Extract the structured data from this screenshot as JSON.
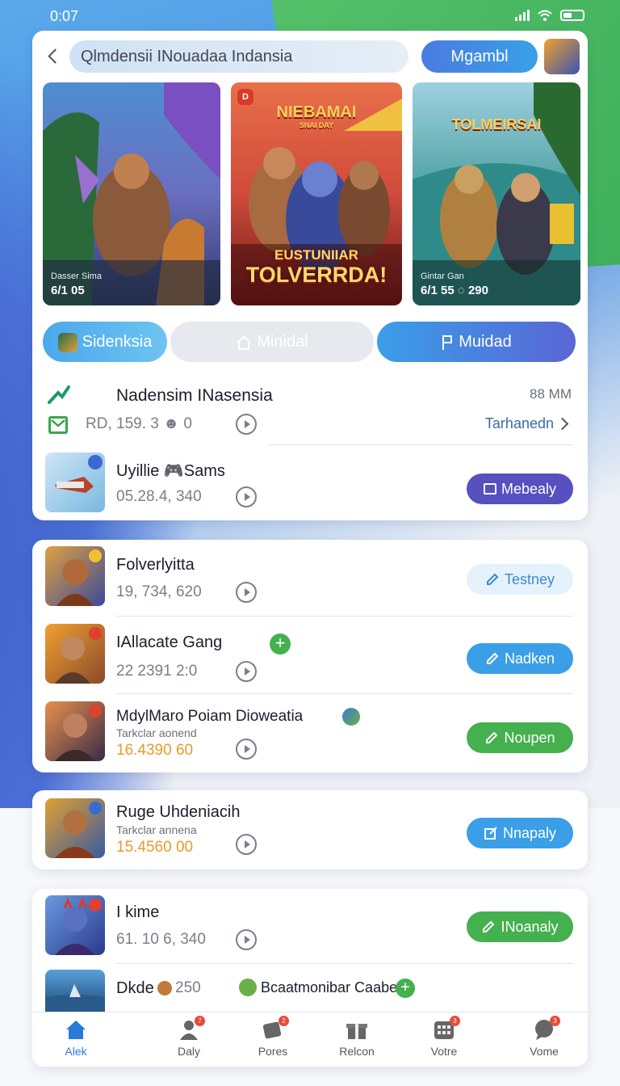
{
  "status": {
    "time": "0:07"
  },
  "header": {
    "search_value": "Qlmdensii INouadaa Indansia",
    "primary_button": "Mgambl"
  },
  "banners": [
    {
      "caption": "Dasser Sima",
      "stats": "6/1 05"
    },
    {
      "badge": "D",
      "top_title": "NIEBAMAI",
      "top_subtitle": "SNAI DAY",
      "title_line1": "EUSTUNIIAR",
      "title_line2": "TOLVERRDA!"
    },
    {
      "top_title": "TOLMEIRSAI",
      "caption": "Gintar Gan",
      "stats": "6/1 55 ◌ 290"
    }
  ],
  "tabs": [
    {
      "label": "Sidenksia"
    },
    {
      "label": "Minidal"
    },
    {
      "label": "Muidad"
    }
  ],
  "section": {
    "title": "Nadensim INasensia",
    "meta": "88 MM",
    "stat": "RD, 159. 3 ☻ 0",
    "link": "Tarhanedn"
  },
  "items": [
    {
      "title": "Uyillie 🎮Sams",
      "stat": "05.28.4, 340",
      "action": "Mebealy",
      "action_color": "#5650c0"
    },
    {
      "title": "Folverlyitta",
      "stat": "19, 734, 620",
      "action": "Testney",
      "action_color": "#e6f2fb"
    },
    {
      "title": "IAllacate Gang",
      "stat": "22 2391 2:0",
      "action": "Nadken",
      "action_color": "#3a9fe6"
    },
    {
      "title": "MdylMaro Poiam Dioweatia",
      "subtitle": "Tarkclar aonend",
      "stat": "16.4390 60",
      "action": "Noupen",
      "action_color": "#45b04e"
    },
    {
      "title": "Ruge Uhdeniacih",
      "subtitle": "Tarkclar annena",
      "stat": "15.4560 00",
      "action": "Nnapaly",
      "action_color": "#3a9fe6"
    },
    {
      "title": "I kime",
      "stat": "61. 10 6, 340",
      "action": "INoanaly",
      "action_color": "#45b04e"
    },
    {
      "title": "Dkde",
      "stat_inline": "250",
      "extra": "Bcaatmonibar Caabe"
    }
  ],
  "nav": [
    {
      "label": "Alek",
      "icon": "home-icon",
      "active": true
    },
    {
      "label": "Daly",
      "icon": "people-icon",
      "badge": "7"
    },
    {
      "label": "Pores",
      "icon": "cards-icon",
      "badge": "2"
    },
    {
      "label": "Relcon",
      "icon": "gift-icon"
    },
    {
      "label": "Votre",
      "icon": "grid-icon",
      "badge": "3"
    },
    {
      "label": "Vome",
      "icon": "chat-icon",
      "badge": "3"
    }
  ]
}
